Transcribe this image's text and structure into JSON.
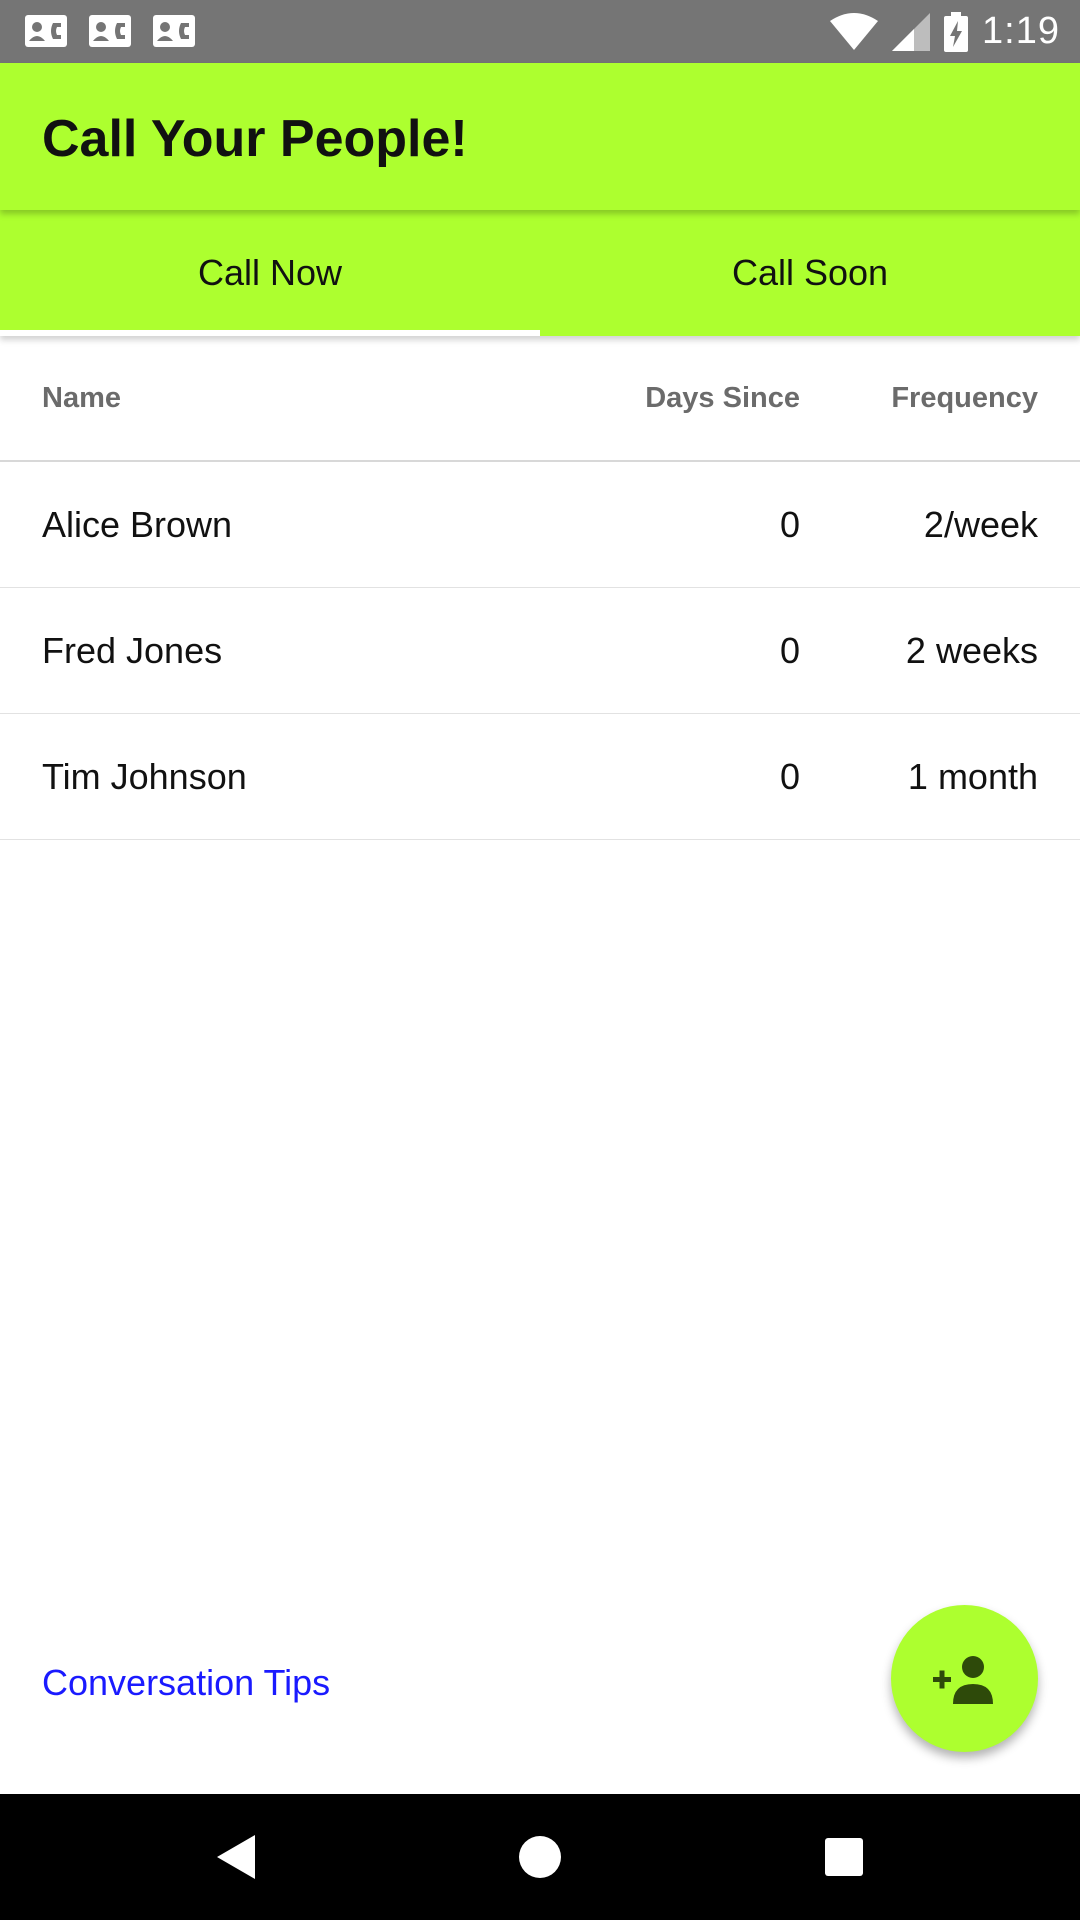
{
  "status_bar": {
    "time": "1:19",
    "notification_icons": [
      "contact-card-icon",
      "contact-card-icon",
      "contact-card-icon"
    ],
    "system_icons": [
      "wifi-icon",
      "cell-signal-icon",
      "battery-charging-icon"
    ]
  },
  "app_bar": {
    "title": "Call Your People!",
    "color": "#adff2f"
  },
  "tabs": [
    {
      "label": "Call Now",
      "selected": true
    },
    {
      "label": "Call Soon",
      "selected": false
    }
  ],
  "table": {
    "headers": {
      "name": "Name",
      "days_since": "Days Since",
      "frequency": "Frequency"
    },
    "rows": [
      {
        "name": "Alice Brown",
        "days_since": "0",
        "frequency": "2/week"
      },
      {
        "name": "Fred Jones",
        "days_since": "0",
        "frequency": "2 weeks"
      },
      {
        "name": "Tim Johnson",
        "days_since": "0",
        "frequency": "1 month"
      }
    ]
  },
  "footer": {
    "link": "Conversation Tips",
    "link_color": "#1a1aff"
  },
  "fab": {
    "icon": "add-person-icon"
  },
  "nav_bar": {
    "icons": [
      "back-icon",
      "home-icon",
      "recent-apps-icon"
    ]
  }
}
